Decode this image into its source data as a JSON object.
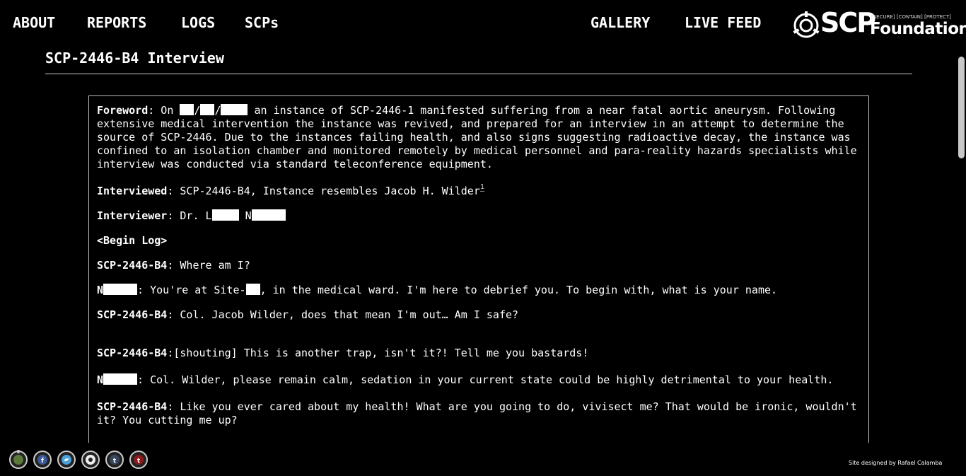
{
  "nav": {
    "about": "ABOUT",
    "reports": "REPORTS",
    "logs": "LOGS",
    "scps": "SCPs",
    "gallery": "GALLERY",
    "live_feed": "LIVE FEED"
  },
  "logo": {
    "scp": "SCP",
    "tagline": "[SECURE] [CONTAIN] [PROTECT]",
    "foundation": "Foundation"
  },
  "page": {
    "title": "SCP-2446-B4 Interview"
  },
  "log": {
    "foreword_label": "Foreword",
    "foreword_on": ": On ",
    "foreword_rest": " an instance of SCP-2446-1 manifested suffering from a near fatal aortic aneurysm. Following extensive medical intervention the instance was revived, and prepared for an interview in an attempt to determine the source of SCP-2446. Due to the instances failing health, and also signs suggesting radioactive decay, the instance was confined to an isolation chamber and monitored remotely by medical personnel and para-reality hazards specialists while interview was conducted via standard teleconference equipment.",
    "interviewed_label": "Interviewed",
    "interviewed_text": ": SCP-2446-B4, Instance resembles Jacob H. Wilder",
    "footnote": "1",
    "interviewer_label": "Interviewer",
    "interviewer_text": ": Dr. L",
    "interviewer_n": "N",
    "begin_log": "<Begin Log>",
    "speaker_b4": "SCP-2446-B4",
    "speaker_n": "N",
    "line1": ": Where am I?",
    "line2_a": ": You're at Site-",
    "line2_b": ", in the medical ward. I'm here to debrief you. To begin with, what is your name.",
    "line3": ": Col. Jacob Wilder, does that mean I'm out… Am I safe?",
    "line4": ":[shouting] This is another trap, isn't it?! Tell me you bastards!",
    "line5": ": Col. Wilder, please remain calm, sedation in your current state could be highly detrimental to your health.",
    "line6": ": Like you ever cared about my health! What are you going to do, vivisect me? That would be ironic, wouldn't it? You cutting me up?"
  },
  "footer": {
    "credit": "Site designed by Rafael Calamba",
    "social_icons": [
      "scp-wiki-icon",
      "facebook-icon",
      "twitter-icon",
      "scp-logo-icon",
      "tumblr-icon",
      "tumblr-red-icon"
    ]
  },
  "colors": {
    "background": "#000000",
    "text": "#ffffff",
    "redaction": "#ffffff"
  }
}
